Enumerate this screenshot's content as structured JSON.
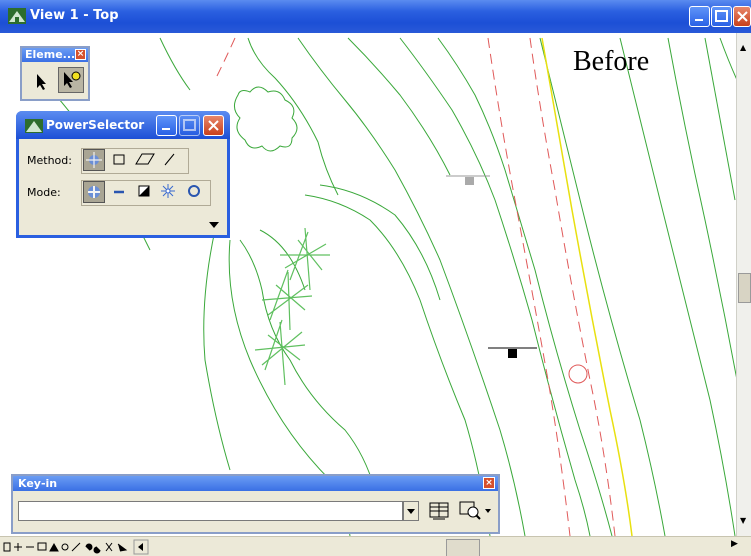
{
  "window": {
    "title": "View 1 - Top"
  },
  "annotation": {
    "text": "Before"
  },
  "element_palette": {
    "title": "Eleme..."
  },
  "power_selector": {
    "title": "PowerSelector",
    "method_label": "Method:",
    "mode_label": "Mode:"
  },
  "keyin": {
    "title": "Key-in",
    "value": ""
  },
  "colors": {
    "title_bar": "#2a5fe0",
    "line_green": "#3aa83a",
    "line_red_dashed": "#e05a5a",
    "line_yellow": "#e8e010",
    "dialog_bg": "#ece9d8"
  }
}
